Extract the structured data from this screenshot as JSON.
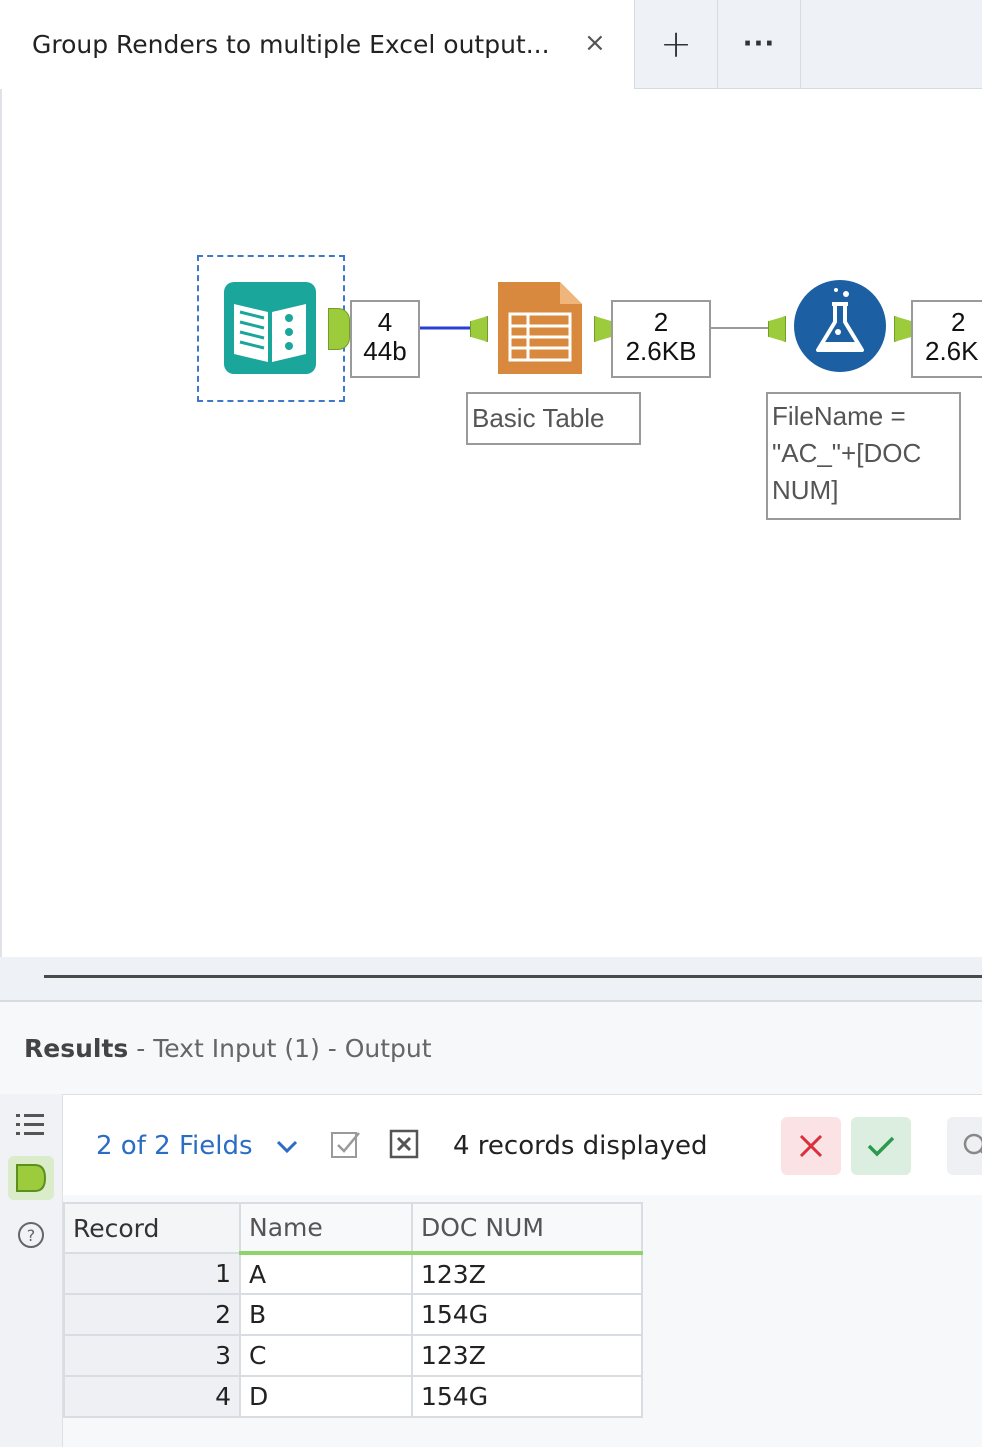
{
  "tabs": {
    "active_title": "Group Renders to multiple Excel output...",
    "close_glyph": "×",
    "new_tab_glyph": "+",
    "more_glyph": "···"
  },
  "workflow": {
    "tools": [
      {
        "name": "Text Input",
        "icon": "text-input-book-icon",
        "color": "#1aa69a"
      },
      {
        "name": "Basic Table",
        "icon": "basic-table-icon",
        "color": "#d8893e"
      },
      {
        "name": "Formula",
        "icon": "formula-flask-icon",
        "color": "#1d5fa3"
      }
    ],
    "connections": [
      {
        "count": "4",
        "size": "44b"
      },
      {
        "count": "2",
        "size": "2.6KB"
      },
      {
        "count": "2",
        "size": "2.6K"
      }
    ],
    "annotations": {
      "basic_table": "Basic Table",
      "formula": "FileName = \"AC_\"+[DOC NUM]"
    }
  },
  "results": {
    "title": "Results",
    "subtitle": "- Text Input (1) - Output",
    "fields_selector": "2 of 2 Fields",
    "records_displayed": "4 records displayed",
    "columns": [
      "Record",
      "Name",
      "DOC NUM"
    ],
    "rows": [
      [
        "1",
        "A",
        "123Z"
      ],
      [
        "2",
        "B",
        "154G"
      ],
      [
        "3",
        "C",
        "123Z"
      ],
      [
        "4",
        "D",
        "154G"
      ]
    ]
  },
  "colors": {
    "accent_blue": "#2b6cc4",
    "anchor_green": "#9ccc3c",
    "selection_blue": "#3f78c8",
    "reject_red": "#d9303b",
    "accept_green": "#2b9a4a"
  }
}
